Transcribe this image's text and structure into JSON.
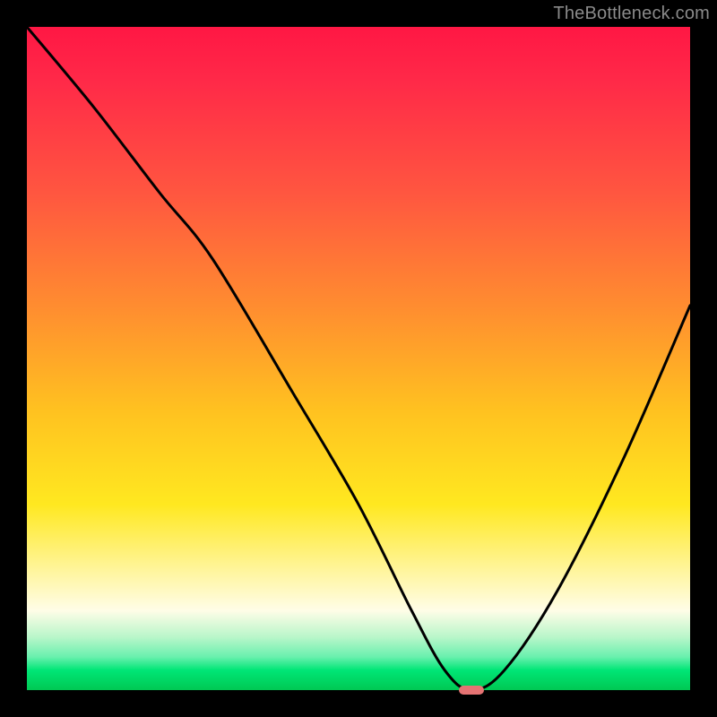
{
  "watermark": "TheBottleneck.com",
  "chart_data": {
    "type": "line",
    "title": "",
    "xlabel": "",
    "ylabel": "",
    "xlim": [
      0,
      100
    ],
    "ylim": [
      0,
      100
    ],
    "series": [
      {
        "name": "bottleneck-curve",
        "x": [
          0,
          10,
          20,
          28,
          40,
          50,
          58,
          63,
          67,
          72,
          80,
          90,
          100
        ],
        "values": [
          100,
          88,
          75,
          65,
          45,
          28,
          12,
          3,
          0,
          3,
          15,
          35,
          58
        ]
      }
    ],
    "marker": {
      "x": 67,
      "y": 0,
      "color": "#e57373"
    },
    "background_gradient": {
      "stops": [
        {
          "pos": 0,
          "color": "#ff1744"
        },
        {
          "pos": 25,
          "color": "#ff5640"
        },
        {
          "pos": 58,
          "color": "#ffc220"
        },
        {
          "pos": 82,
          "color": "#fff59d"
        },
        {
          "pos": 95,
          "color": "#69f0ae"
        },
        {
          "pos": 100,
          "color": "#00c853"
        }
      ]
    }
  }
}
